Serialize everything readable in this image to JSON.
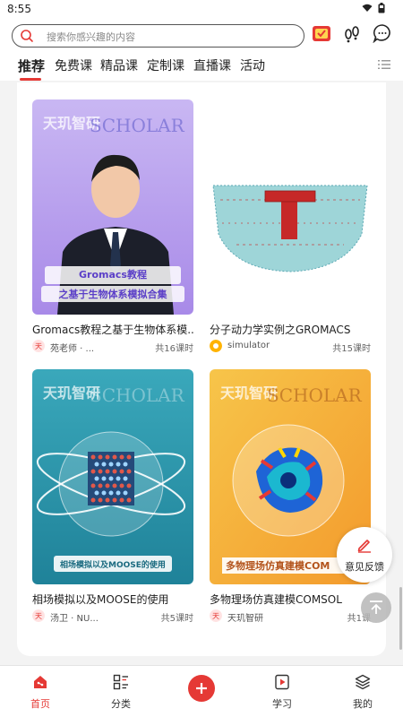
{
  "status_bar": {
    "time": "8:55"
  },
  "search": {
    "placeholder": "搜索你感兴趣的内容"
  },
  "tabs": [
    {
      "label": "推荐",
      "active": true
    },
    {
      "label": "免费课"
    },
    {
      "label": "精品课"
    },
    {
      "label": "定制课"
    },
    {
      "label": "直播课"
    },
    {
      "label": "活动"
    }
  ],
  "courses": [
    {
      "title": "Gromacs教程之基于生物体系模...",
      "author": "苑老师 · ...",
      "lessons": "共16课时",
      "thumb_text": {
        "brand_cn": "天玑智研",
        "brand_en": "SCHOLAR",
        "caption_1": "Gromacs教程",
        "caption_2": "之基于生物体系模拟合集"
      },
      "bg": "#c9b7f3"
    },
    {
      "title": "分子动力学实例之GROMACS",
      "author": "simulator",
      "lessons": "共15课时",
      "bg": "#ffffff"
    },
    {
      "title": "相场模拟以及MOOSE的使用",
      "author": "汤卫 · NU...",
      "lessons": "共5课时",
      "thumb_text": {
        "brand_cn": "天玑智研",
        "brand_en": "SCHOLAR",
        "caption_1": "相场模拟以及MOOSE的使用"
      },
      "bg": "#2e9bb0"
    },
    {
      "title": "多物理场仿真建模COMSOL",
      "author": "天玑智研",
      "lessons": "共1课",
      "thumb_text": {
        "brand_cn": "天玑智研",
        "brand_en": "SCHOLAR",
        "caption_1": "多物理场仿真建模COM"
      },
      "bg": "#f4b43a"
    }
  ],
  "floating": {
    "feedback_label": "意见反馈"
  },
  "bottom_nav": [
    {
      "label": "首页",
      "icon": "home-icon",
      "active": true
    },
    {
      "label": "分类",
      "icon": "category-icon"
    },
    {
      "label": "",
      "icon": "plus-icon"
    },
    {
      "label": "学习",
      "icon": "study-icon"
    },
    {
      "label": "我的",
      "icon": "profile-icon"
    }
  ],
  "colors": {
    "accent": "#e53935",
    "page_bg": "#f3f3f3"
  }
}
